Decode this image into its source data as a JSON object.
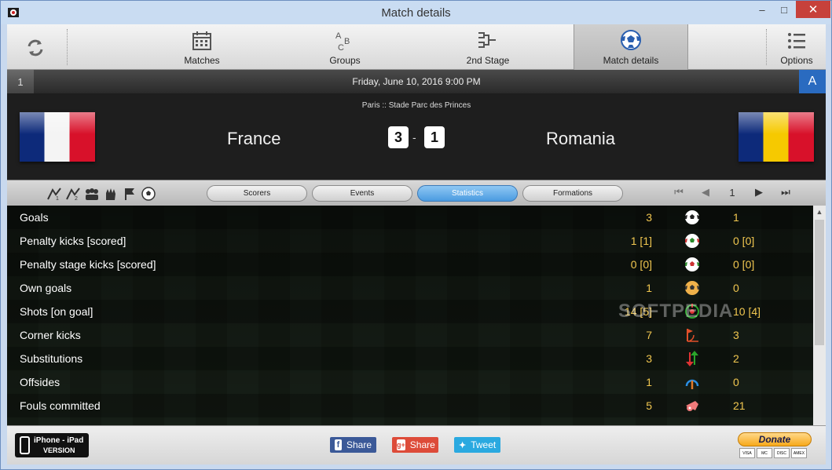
{
  "window": {
    "title": "Match details",
    "minimize": "–",
    "maximize": "□",
    "close": "✕"
  },
  "toolbar": {
    "items": [
      {
        "label": "Matches",
        "icon": "calendar-icon"
      },
      {
        "label": "Groups",
        "icon": "groups-abc-icon"
      },
      {
        "label": "2nd Stage",
        "icon": "bracket-icon"
      },
      {
        "label": "Match details",
        "icon": "soccer-ball-icon",
        "active": true
      },
      {
        "label": "Options",
        "icon": "options-list-icon"
      }
    ]
  },
  "match": {
    "number": "1",
    "group": "A",
    "date": "Friday, June 10, 2016 9:00 PM",
    "venue": "Paris  ::  Stade Parc des Princes",
    "home_team": "France",
    "away_team": "Romania",
    "home_score": "3",
    "away_score": "1",
    "score_separator": "-"
  },
  "tabs": {
    "items": [
      "Scorers",
      "Events",
      "Statistics",
      "Formations"
    ],
    "active": "Statistics"
  },
  "pager": {
    "first": "⏮",
    "prev": "◀",
    "page": "1",
    "next": "▶",
    "last": "⏭"
  },
  "stats": [
    {
      "label": "Goals",
      "home": "3",
      "away": "1",
      "icon": "ball-icon"
    },
    {
      "label": "Penalty kicks [scored]",
      "home": "1 [1]",
      "away": "0 [0]",
      "icon": "penalty-ball-icon"
    },
    {
      "label": "Penalty stage kicks [scored]",
      "home": "0 [0]",
      "away": "0 [0]",
      "icon": "penalty-stage-ball-icon"
    },
    {
      "label": "Own goals",
      "home": "1",
      "away": "0",
      "icon": "own-goal-ball-icon"
    },
    {
      "label": "Shots [on goal]",
      "home": "14 [5]",
      "away": "10 [4]",
      "icon": "shots-target-icon"
    },
    {
      "label": "Corner kicks",
      "home": "7",
      "away": "3",
      "icon": "corner-flag-icon"
    },
    {
      "label": "Substitutions",
      "home": "3",
      "away": "2",
      "icon": "substitution-arrows-icon"
    },
    {
      "label": "Offsides",
      "home": "1",
      "away": "0",
      "icon": "offside-icon"
    },
    {
      "label": "Fouls committed",
      "home": "5",
      "away": "21",
      "icon": "whistle-icon"
    }
  ],
  "watermark": "SOFTPEDIA",
  "footer": {
    "app_line1": "iPhone - iPad",
    "app_line2": "VERSION",
    "share_facebook": "Share",
    "share_google": "Share",
    "tweet": "Tweet",
    "donate": "Donate",
    "cards": [
      "VISA",
      "MC",
      "DISC",
      "AMEX"
    ]
  },
  "colors": {
    "accent_blue": "#2a6bc0",
    "stat_value": "#f1c750",
    "tab_active": "#4b9be0"
  }
}
